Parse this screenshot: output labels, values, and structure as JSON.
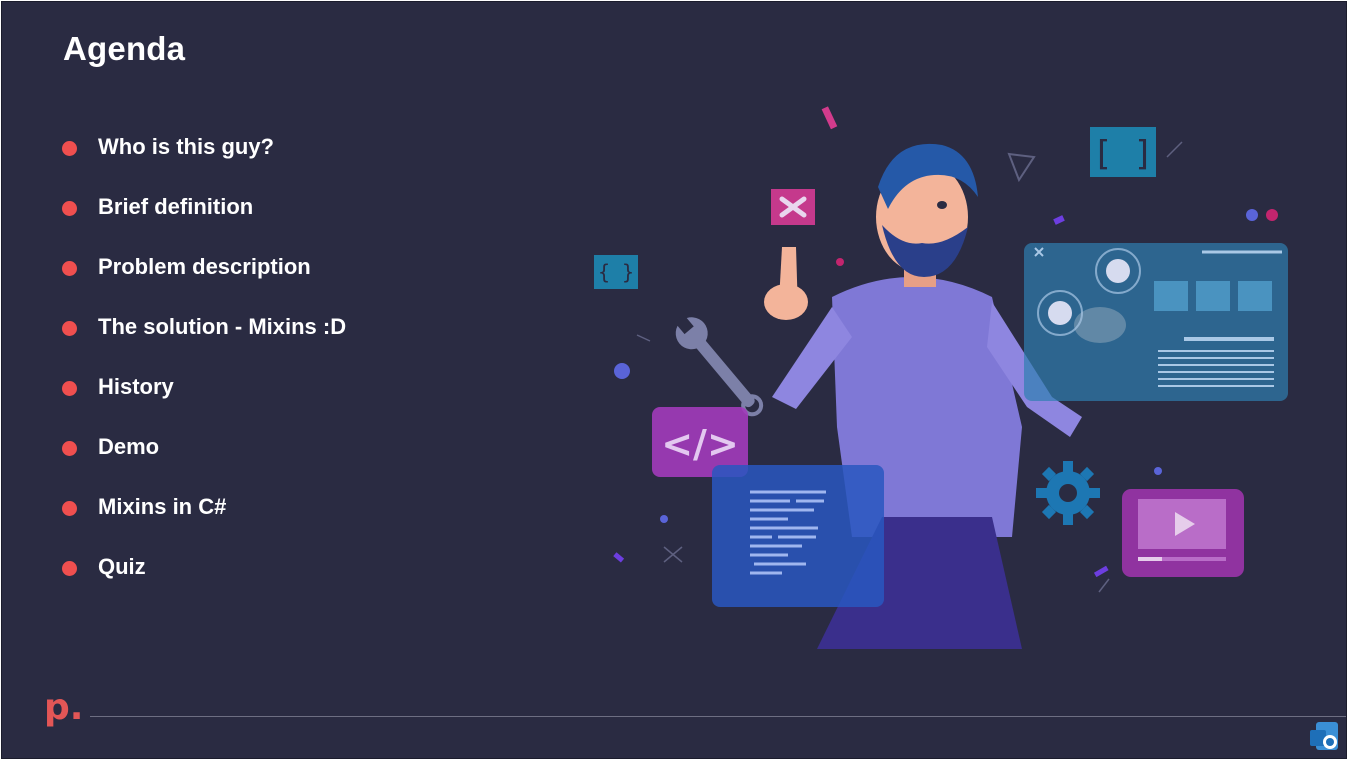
{
  "slide": {
    "title": "Agenda",
    "agenda_items": [
      "Who is this guy?",
      "Brief definition",
      "Problem description",
      "The solution - Mixins :D",
      "History",
      "Demo",
      "Mixins in C#",
      "Quiz"
    ],
    "logo_text": "p."
  },
  "colors": {
    "background": "#2a2b42",
    "bullet": "#ef4f4f",
    "text": "#ffffff",
    "logo": "#e35656",
    "footer_line": "#6d6e82"
  },
  "icons": {
    "illustration": "developer-touching-screens-illustration",
    "corner": "powerpoint-teams-icon"
  }
}
